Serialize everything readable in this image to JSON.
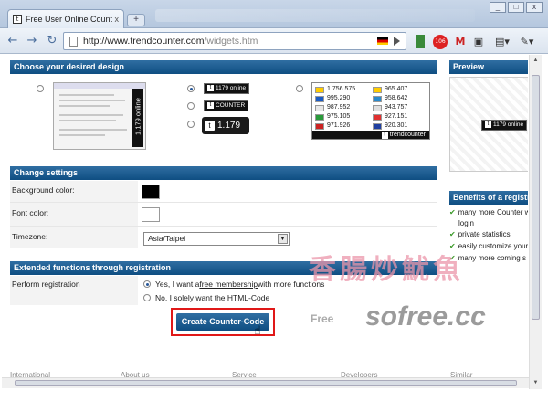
{
  "browser": {
    "tab_title": "Free User Online Count...",
    "tab_close": "x",
    "new_tab": "+",
    "url_host": "http://www.trendcounter.com",
    "url_path": "/widgets.htm",
    "window_buttons": [
      "_",
      "□",
      "x"
    ],
    "mail_badge": "106"
  },
  "sections": {
    "design": "Choose your desired design",
    "settings": "Change settings",
    "extended": "Extended functions through registration"
  },
  "designs": {
    "vertical_badge_text": "1.179 online",
    "small_online": "1179 online",
    "small_counter": "COUNTER",
    "big_count": "1.179",
    "t_glyph": "t",
    "flag_rows_left": [
      "1.756.575",
      "995.290",
      "987.952",
      "975.105",
      "971.926"
    ],
    "flag_rows_right": [
      "965.407",
      "958.642",
      "943.757",
      "927.151",
      "920.301"
    ],
    "flag_colors_left": [
      "#ffcc00",
      "#1a5bc4",
      "#e8e8e8",
      "#2a9a3a",
      "#cc2222"
    ],
    "flag_colors_right": [
      "#ffcc00",
      "#2a8acc",
      "#e0e0e0",
      "#e03030",
      "#1f3fa0"
    ],
    "brand": "trendcounter"
  },
  "settings": {
    "background_label": "Background color:",
    "font_label": "Font color:",
    "timezone_label": "Timezone:",
    "timezone_value": "Asia/Taipei",
    "background_color": "#000000",
    "font_color": "#ffffff"
  },
  "extended": {
    "perform_label": "Perform registration",
    "yes_prefix": "Yes, I want a ",
    "yes_link": "free membership",
    "yes_suffix": " with more functions",
    "no_text": "No, I solely want the HTML-Code",
    "create_button": "Create Counter-Code"
  },
  "preview": {
    "title": "Preview",
    "badge": "1179 online"
  },
  "benefits": {
    "title": "Benefits of a registra",
    "items": [
      "many more Counter with",
      "login",
      "private statistics",
      "easily customize your",
      "many more coming s"
    ]
  },
  "footer": [
    "International",
    "About us",
    "Service",
    "Developers",
    "Similar"
  ],
  "watermark": {
    "cn": "香腸炒魷魚",
    "domain": "sofree.cc",
    "free": "Free"
  }
}
